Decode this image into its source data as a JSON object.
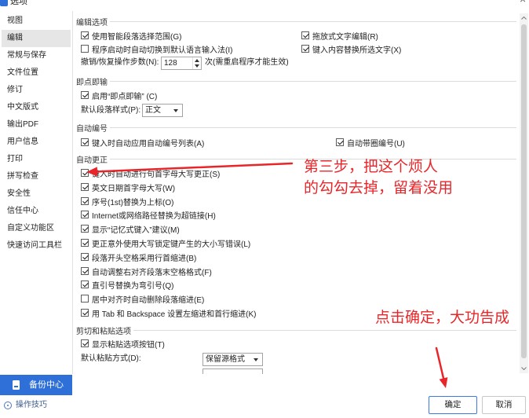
{
  "window": {
    "title": "选项",
    "close": "×"
  },
  "colors": {
    "accent": "#2f6fd8",
    "focus_border": "#3b7be3",
    "selected_bg": "#e6e6e6",
    "annotation": "#e8262a"
  },
  "sidebar": {
    "items": [
      {
        "label": "视图",
        "selected": false
      },
      {
        "label": "编辑",
        "selected": true
      },
      {
        "label": "常规与保存",
        "selected": false
      },
      {
        "label": "文件位置",
        "selected": false
      },
      {
        "label": "修订",
        "selected": false
      },
      {
        "label": "中文版式",
        "selected": false
      },
      {
        "label": "输出PDF",
        "selected": false
      },
      {
        "label": "用户信息",
        "selected": false
      },
      {
        "label": "打印",
        "selected": false
      },
      {
        "label": "拼写检查",
        "selected": false
      },
      {
        "label": "安全性",
        "selected": false
      },
      {
        "label": "信任中心",
        "selected": false
      },
      {
        "label": "自定义功能区",
        "selected": false
      },
      {
        "label": "快速访问工具栏",
        "selected": false
      }
    ],
    "backup_center": {
      "label": "备份中心",
      "icon": "backup-icon"
    },
    "tips": {
      "label": "操作技巧",
      "icon": "lightbulb-icon"
    }
  },
  "edit_options": {
    "title": "编辑选项",
    "smart_paragraph": {
      "label": "使用智能段落选择范围(G)",
      "checked": true
    },
    "drag_drop": {
      "label": "拖放式文字编辑(R)",
      "checked": true
    },
    "auto_ime": {
      "label": "程序启动时自动切换到默认语言输入法(I)",
      "checked": false
    },
    "typing_replaces": {
      "label": "键入内容替换所选文字(X)",
      "checked": true
    },
    "undo_steps": {
      "label": "撤销/恢复操作步数(N):",
      "value": "128",
      "suffix": "次(需重启程序才能生效)"
    }
  },
  "click_and_type": {
    "title": "即点即输",
    "enable": {
      "label": "启用“即点即输” (C)",
      "checked": true
    },
    "default_style": {
      "label": "默认段落样式(P):",
      "value": "正文"
    }
  },
  "auto_numbering": {
    "title": "自动编号",
    "apply_list": {
      "label": "键入时自动应用自动编号列表(A)",
      "checked": true
    },
    "circled": {
      "label": "自动带圈编号(U)",
      "checked": true
    }
  },
  "autocorrect": {
    "title": "自动更正",
    "items": [
      {
        "label": "键入时自动进行句首字母大写更正(S)",
        "checked": true
      },
      {
        "label": "英文日期首字母大写(W)",
        "checked": true
      },
      {
        "label": "序号(1st)替换为上标(O)",
        "checked": true
      },
      {
        "label": "Internet或网络路径替换为超链接(H)",
        "checked": true
      },
      {
        "label": "显示“记忆式键入”建议(M)",
        "checked": true
      },
      {
        "label": "更正意外使用大写锁定键产生的大小写错误(L)",
        "checked": true
      },
      {
        "label": "段落开头空格采用行首缩进(B)",
        "checked": true
      },
      {
        "label": "自动调整右对齐段落末空格格式(F)",
        "checked": true
      },
      {
        "label": "直引号替换为弯引号(Q)",
        "checked": true
      },
      {
        "label": "居中对齐时自动删除段落缩进(E)",
        "checked": false
      },
      {
        "label": "用 Tab 和 Backspace 设置左缩进和首行缩进(K)",
        "checked": true
      }
    ]
  },
  "cut_paste": {
    "title": "剪切和粘贴选项",
    "show_button": {
      "label": "显示粘贴选项按钮(T)",
      "checked": true
    },
    "default_paste": {
      "label": "默认粘贴方式(D):",
      "value": "保留源格式"
    }
  },
  "annotations": {
    "step3_line1": "第三步，把这个烦人",
    "step3_line2": "的勾勾去掉，留着没用",
    "confirm_hint": "点击确定，大功告成"
  },
  "footer": {
    "ok": "确定",
    "cancel": "取消"
  }
}
